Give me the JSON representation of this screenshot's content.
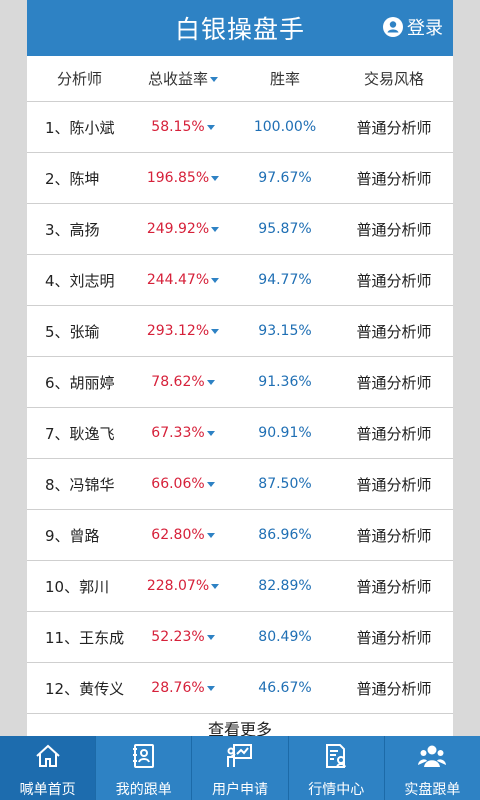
{
  "header": {
    "title": "白银操盘手",
    "login_label": "登录"
  },
  "table": {
    "columns": [
      "分析师",
      "总收益率",
      "胜率",
      "交易风格"
    ],
    "rows": [
      {
        "name": "1、陈小斌",
        "total_return": "58.15%",
        "win_rate": "100.00%",
        "style": "普通分析师"
      },
      {
        "name": "2、陈坤",
        "total_return": "196.85%",
        "win_rate": "97.67%",
        "style": "普通分析师"
      },
      {
        "name": "3、高扬",
        "total_return": "249.92%",
        "win_rate": "95.87%",
        "style": "普通分析师"
      },
      {
        "name": "4、刘志明",
        "total_return": "244.47%",
        "win_rate": "94.77%",
        "style": "普通分析师"
      },
      {
        "name": "5、张瑜",
        "total_return": "293.12%",
        "win_rate": "93.15%",
        "style": "普通分析师"
      },
      {
        "name": "6、胡丽婷",
        "total_return": "78.62%",
        "win_rate": "91.36%",
        "style": "普通分析师"
      },
      {
        "name": "7、耿逸飞",
        "total_return": "67.33%",
        "win_rate": "90.91%",
        "style": "普通分析师"
      },
      {
        "name": "8、冯锦华",
        "total_return": "66.06%",
        "win_rate": "87.50%",
        "style": "普通分析师"
      },
      {
        "name": "9、曾路",
        "total_return": "62.80%",
        "win_rate": "86.96%",
        "style": "普通分析师"
      },
      {
        "name": "10、郭川",
        "total_return": "228.07%",
        "win_rate": "82.89%",
        "style": "普通分析师"
      },
      {
        "name": "11、王东成",
        "total_return": "52.23%",
        "win_rate": "80.49%",
        "style": "普通分析师"
      },
      {
        "name": "12、黄传义",
        "total_return": "28.76%",
        "win_rate": "46.67%",
        "style": "普通分析师"
      }
    ],
    "more_label": "查看更多"
  },
  "tabbar": {
    "items": [
      {
        "label": "喊单首页",
        "icon": "home-icon",
        "active": true
      },
      {
        "label": "我的跟单",
        "icon": "profile-card-icon",
        "active": false
      },
      {
        "label": "用户申请",
        "icon": "presenter-board-icon",
        "active": false
      },
      {
        "label": "行情中心",
        "icon": "document-user-icon",
        "active": false
      },
      {
        "label": "实盘跟单",
        "icon": "group-users-icon",
        "active": false
      }
    ]
  },
  "colors": {
    "brand": "#2e82c4",
    "return_red": "#d6213a",
    "winrate_blue": "#1f6fb4"
  }
}
